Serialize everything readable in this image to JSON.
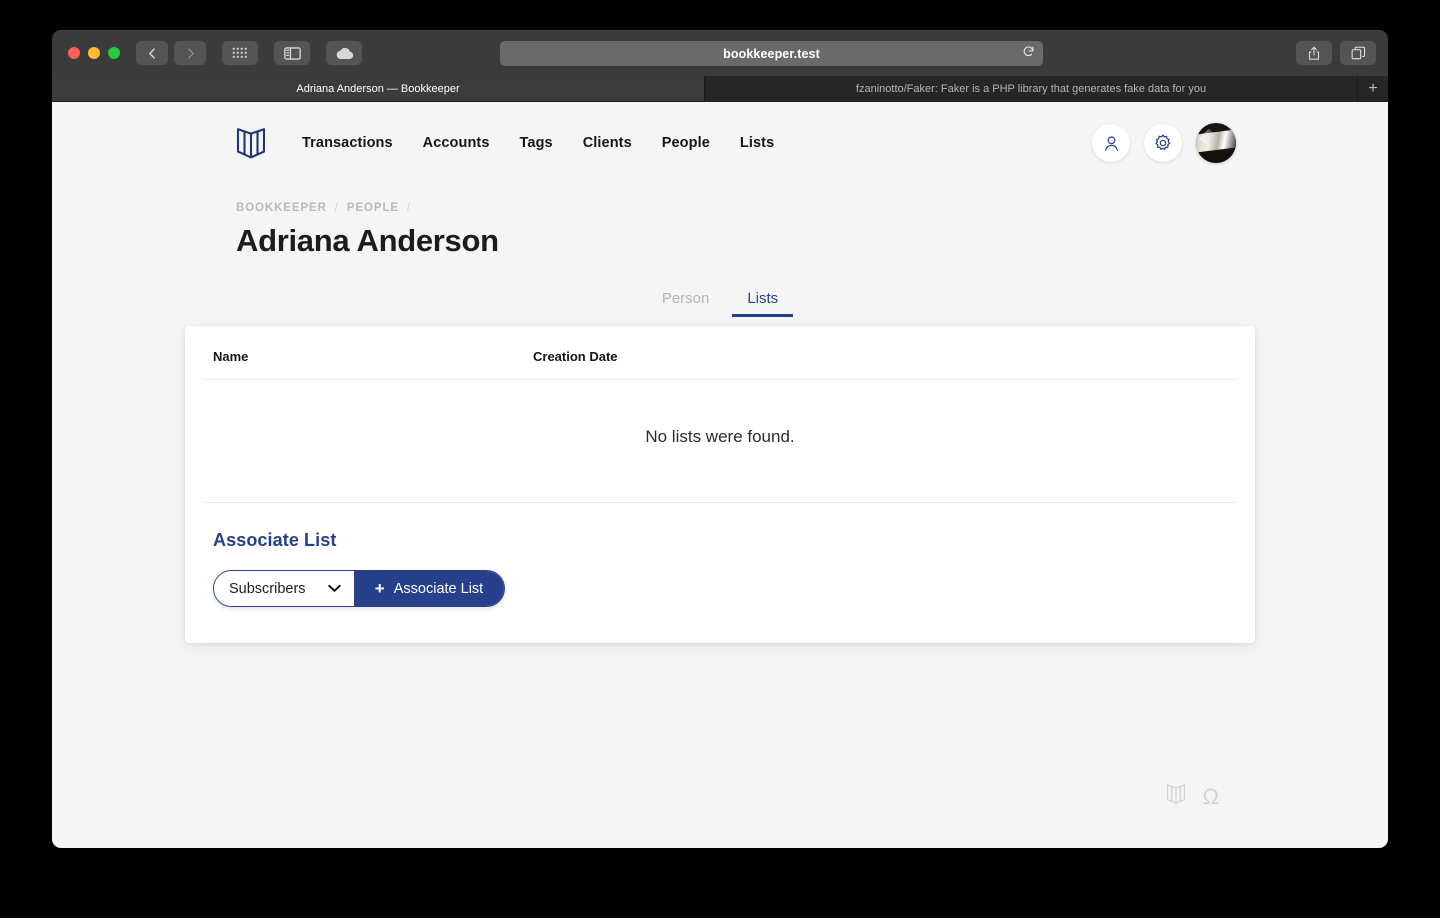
{
  "browser": {
    "traffic_lights": [
      "close",
      "minimize",
      "maximize"
    ],
    "toolbar_icons": [
      "back-arrow-icon",
      "forward-arrow-icon",
      "tab-overview-grid-icon",
      "sidebar-toggle-icon",
      "icloud-cloud-icon",
      "share-icon",
      "new-tab-icon"
    ],
    "address": {
      "url": "bookkeeper.test",
      "reload_icon": "reload-icon"
    },
    "tabs": [
      {
        "title": "Adriana Anderson — Bookkeeper",
        "active": true
      },
      {
        "title": "fzaninotto/Faker: Faker is a PHP library that generates fake data for you",
        "active": false
      }
    ],
    "new_tab_label": "+"
  },
  "app": {
    "logo_icon": "open-book-logo-icon",
    "nav_links": [
      {
        "label": "Transactions"
      },
      {
        "label": "Accounts"
      },
      {
        "label": "Tags"
      },
      {
        "label": "Clients"
      },
      {
        "label": "People"
      },
      {
        "label": "Lists"
      }
    ],
    "nav_actions": [
      {
        "icon": "person-icon"
      },
      {
        "icon": "gear-icon"
      },
      {
        "icon": "avatar-photo"
      }
    ],
    "breadcrumb": {
      "items": [
        "BOOKKEEPER",
        "PEOPLE"
      ],
      "separator": "/",
      "trailing_separator": "/"
    },
    "page_title": "Adriana Anderson",
    "tabs": [
      {
        "label": "Person",
        "active": false
      },
      {
        "label": "Lists",
        "active": true
      }
    ],
    "table": {
      "columns": [
        "Name",
        "Creation Date"
      ],
      "rows": [],
      "empty_message": "No lists were found."
    },
    "associate": {
      "heading": "Associate List",
      "select_value": "Subscribers",
      "select_chevron_icon": "chevron-down-icon",
      "button_label": "Associate List",
      "button_plus_icon": "plus-icon"
    },
    "footer_icons": [
      {
        "icon": "open-book-icon"
      },
      {
        "icon": "omega-icon",
        "glyph": "Ω"
      }
    ]
  },
  "colors": {
    "accent_navy": "#27408b",
    "page_bg": "#f5f5f5",
    "card_bg": "#ffffff",
    "muted_text": "#b9b9b9"
  }
}
